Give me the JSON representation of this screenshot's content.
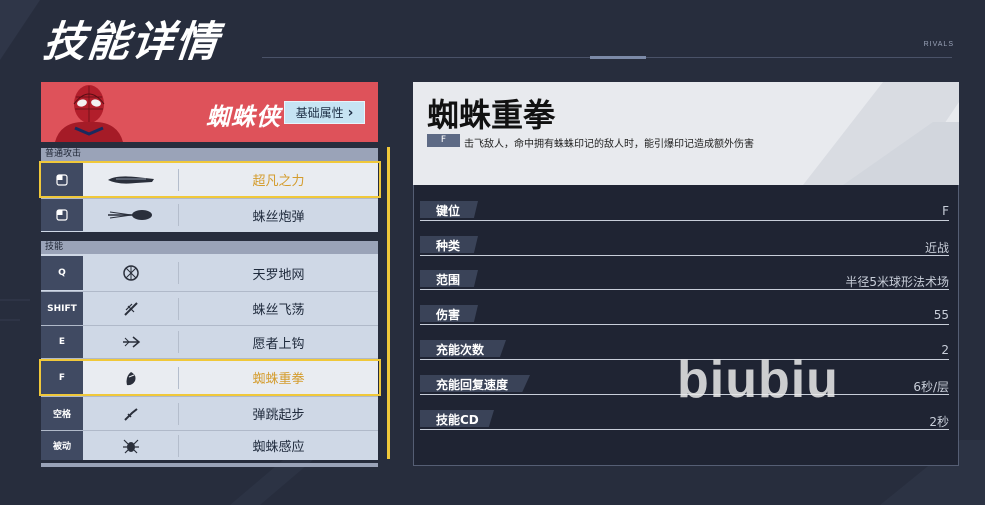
{
  "page_title": "技能详情",
  "brand_tag": "RIVALS",
  "hero": {
    "name": "蜘蛛侠",
    "attr_button_label": "基础属性",
    "attr_button_chevron": "›"
  },
  "sections": {
    "normal_attack": "普通攻击",
    "skills": "技能"
  },
  "normal_attacks": [
    {
      "key": "mouse-left-icon",
      "name": "超凡之力",
      "selected": true
    },
    {
      "key": "mouse-left-icon",
      "name": "蛛丝炮弹",
      "selected": false
    }
  ],
  "skills": [
    {
      "key": "Q",
      "name": "天罗地网",
      "selected": false
    },
    {
      "key": "SHIFT",
      "name": "蛛丝飞荡",
      "selected": false
    },
    {
      "key": "E",
      "name": "愿者上钩",
      "selected": false
    },
    {
      "key": "F",
      "name": "蜘蛛重拳",
      "selected": true
    },
    {
      "key": "空格",
      "name": "弹跳起步",
      "selected": false
    },
    {
      "key": "被动",
      "name": "蜘蛛感应",
      "selected": false
    }
  ],
  "detail": {
    "title": "蜘蛛重拳",
    "key": "F",
    "description": "击飞敌人，命中拥有蛛蛛印记的敌人时，能引爆印记造成额外伤害",
    "stats": [
      {
        "label": "键位",
        "value": "F"
      },
      {
        "label": "种类",
        "value": "近战"
      },
      {
        "label": "范围",
        "value": "半径5米球形法术场"
      },
      {
        "label": "伤害",
        "value": "55"
      },
      {
        "label": "充能次数",
        "value": "2"
      },
      {
        "label": "充能回复速度",
        "value": "6秒/层"
      },
      {
        "label": "技能CD",
        "value": "2秒"
      }
    ]
  },
  "watermark": "biubiu",
  "colors": {
    "background": "#272d3d",
    "hero_red": "#de525a",
    "selected_gold": "#d49c2d",
    "highlight_yellow": "#f0c83a"
  }
}
